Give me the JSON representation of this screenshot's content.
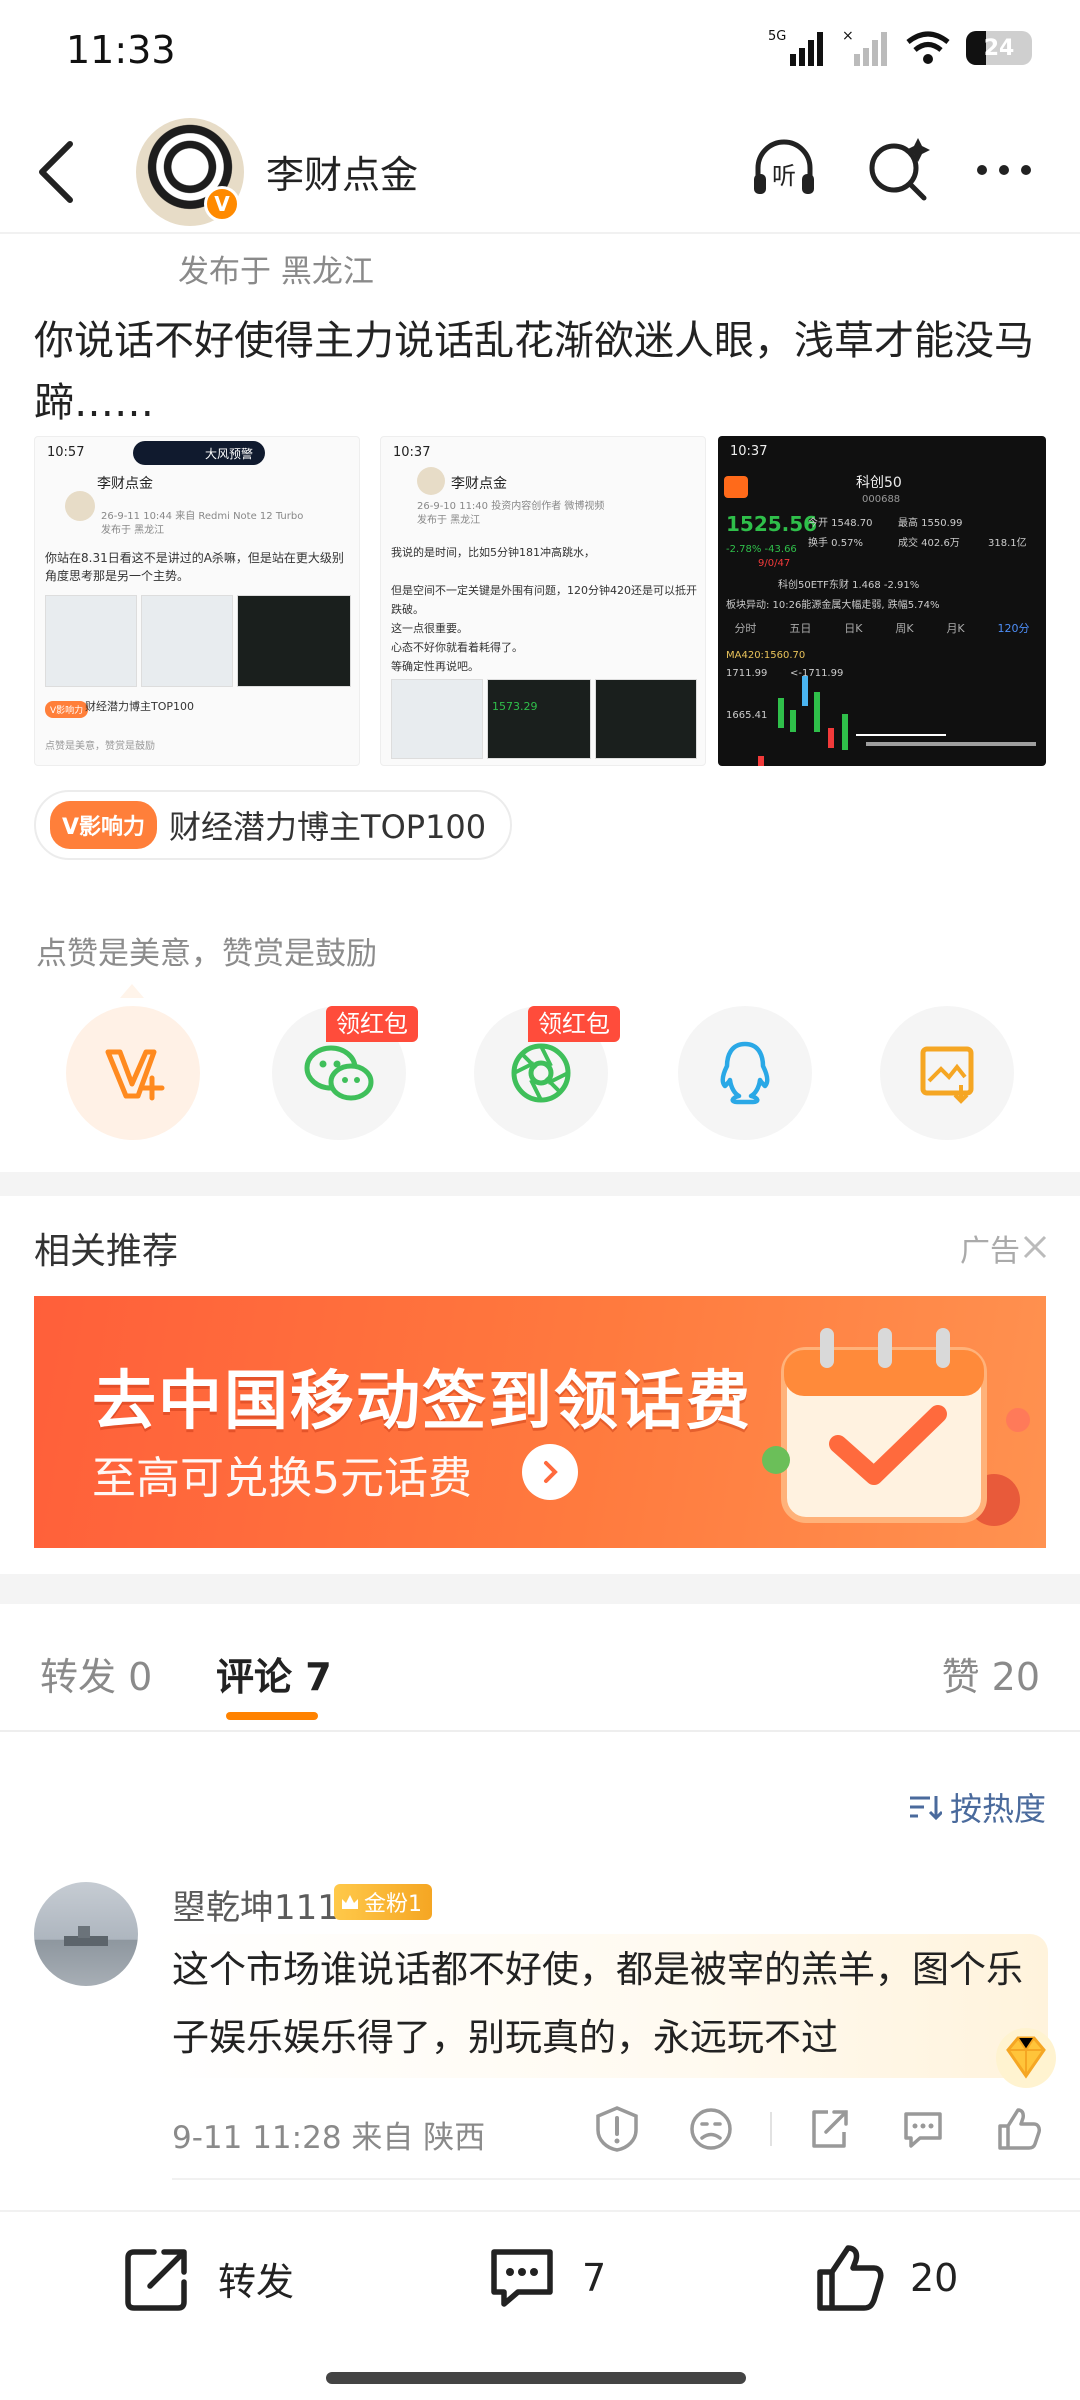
{
  "status_bar": {
    "time": "11:33",
    "battery": "24",
    "network_label": "5G"
  },
  "header": {
    "account_name": "李财点金",
    "icons": [
      "back-icon",
      "listen-icon",
      "search-icon",
      "more-icon"
    ]
  },
  "post": {
    "published_from": "发布于 黑龙江",
    "text": "你说话不好使得主力说话乱花渐欲迷人眼，浅草才能没马蹄……",
    "thumbnails": [
      {
        "time": "10:57",
        "pill": "大风预警",
        "name": "李财点金",
        "meta": "26-9-11 10:44  来自 Redmi Note 12 Turbo",
        "location": "发布于 黑龙江",
        "body": "你站在8.31日看这不是讲过的A杀嘛，但是站在更大级别角度思考那是另一个主势。",
        "badge": "财经潜力博主TOP100",
        "note": "点赞是美意，赞赏是鼓励"
      },
      {
        "time": "10:37",
        "name": "李财点金",
        "meta": "26-9-10 11:40  投资内容创作者 微博视频",
        "location": "发布于 黑龙江",
        "body": "我说的是时间，比如5分钟181冲高跳水，\n\n但是空间不一定关键是外围有问题，120分钟420还是可以抵开跌破。\n这一点很重要。\n心态不好你就看着耗得了。\n等确定性再说吧。",
        "price": "1573.29"
      },
      {
        "time": "10:37",
        "title": "科创50",
        "code": "000688",
        "price": "1525.56",
        "change": "-2.78%  -43.66",
        "open": "今开 1548.70",
        "high": "最高 1550.99",
        "turnover": "换手 0.57%",
        "volume": "成交 402.6万",
        "amount": "318.1亿",
        "up_down": "9/0/47",
        "etf": "科创50ETF东财 1.468 -2.91%",
        "news": "板块异动: 10:26能源金属大幅走弱, 跌幅5.74%",
        "periods": [
          "分时",
          "五日",
          "日K",
          "周K",
          "月K",
          "120分"
        ],
        "ma": "MA420:1560.70",
        "y_labels": [
          "1711.99",
          "1665.41"
        ],
        "arrow_label": "<-1711.99"
      }
    ],
    "influence_badge": {
      "tag": "V影响力",
      "text": "财经潜力博主TOP100"
    }
  },
  "praise": {
    "note": "点赞是美意，赞赏是鼓励",
    "actions": [
      {
        "name": "tip-v-icon"
      },
      {
        "name": "wechat-icon",
        "tag": "领红包"
      },
      {
        "name": "moments-icon",
        "tag": "领红包"
      },
      {
        "name": "qq-icon"
      },
      {
        "name": "save-image-icon"
      }
    ]
  },
  "recommend": {
    "title": "相关推荐",
    "ad_label": "广告",
    "banner_main": "去中国移动签到领话费",
    "banner_sub": "至高可兑换5元话费"
  },
  "tabs": {
    "repost": "转发 0",
    "comment": "评论 7",
    "like": "赞 20"
  },
  "sort_label": "按热度",
  "comment": {
    "user": "曌乾坤111",
    "fan_badge": "金粉1",
    "text": "这个市场谁说话都不好使，都是被宰的羔羊，图个乐子娱乐娱乐得了，别玩真的，永远玩不过",
    "meta": "9-11 11:28  来自 陕西"
  },
  "bottom_bar": {
    "repost_label": "转发",
    "comment_count": "7",
    "like_count": "20"
  },
  "colors": {
    "accent": "#ff8200",
    "link": "#4a6a9c",
    "hongbao": "#ff4c3b",
    "ad_orange": "#ff6a3d",
    "stock_up_green": "#2fbf4a",
    "stock_down_red": "#f23a3a"
  }
}
